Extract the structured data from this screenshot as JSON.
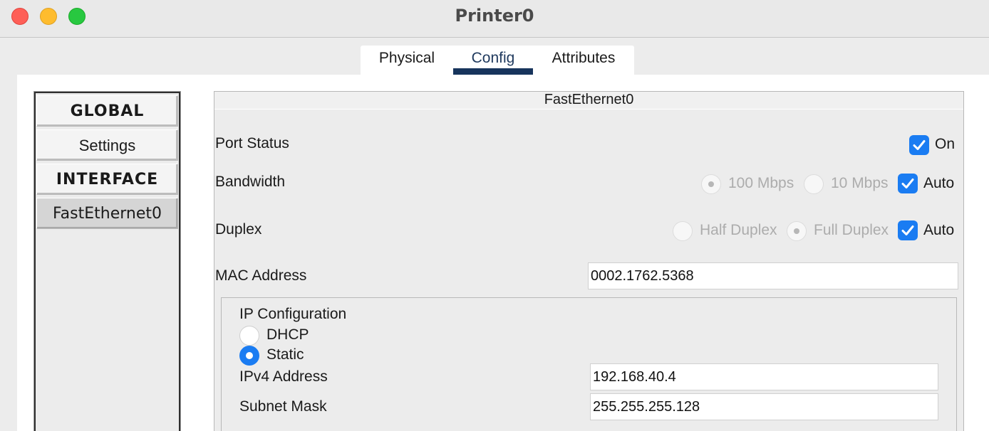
{
  "window": {
    "title": "Printer0"
  },
  "tabs": [
    {
      "label": "Physical",
      "active": false
    },
    {
      "label": "Config",
      "active": true
    },
    {
      "label": "Attributes",
      "active": false
    }
  ],
  "sidebar": {
    "items": [
      {
        "label": "GLOBAL",
        "type": "header"
      },
      {
        "label": "Settings",
        "type": "item"
      },
      {
        "label": "INTERFACE",
        "type": "header"
      },
      {
        "label": "FastEthernet0",
        "type": "item",
        "selected": true
      }
    ]
  },
  "interface": {
    "title": "FastEthernet0",
    "port_status": {
      "label": "Port Status",
      "checkbox_label": "On",
      "checked": true
    },
    "bandwidth": {
      "label": "Bandwidth",
      "options": [
        {
          "label": "100 Mbps",
          "selected": true,
          "disabled": true
        },
        {
          "label": "10 Mbps",
          "selected": false,
          "disabled": true
        }
      ],
      "auto_label": "Auto",
      "auto_checked": true
    },
    "duplex": {
      "label": "Duplex",
      "options": [
        {
          "label": "Half Duplex",
          "selected": false,
          "disabled": true
        },
        {
          "label": "Full Duplex",
          "selected": true,
          "disabled": true
        }
      ],
      "auto_label": "Auto",
      "auto_checked": true
    },
    "mac": {
      "label": "MAC Address",
      "value": "0002.1762.5368"
    },
    "ip_config": {
      "title": "IP Configuration",
      "modes": [
        {
          "label": "DHCP",
          "selected": false
        },
        {
          "label": "Static",
          "selected": true
        }
      ],
      "ipv4": {
        "label": "IPv4 Address",
        "value": "192.168.40.4"
      },
      "mask": {
        "label": "Subnet Mask",
        "value": "255.255.255.128"
      }
    }
  },
  "colors": {
    "accent": "#1a7cf2",
    "tab_underline": "#17345c"
  }
}
